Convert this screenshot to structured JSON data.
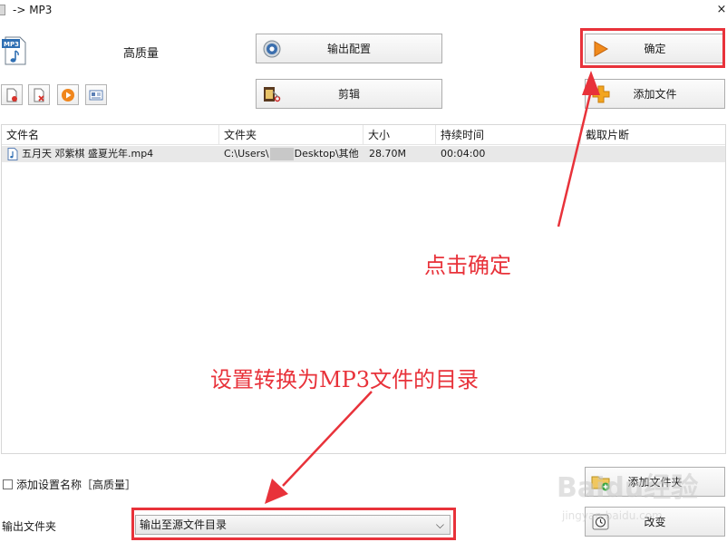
{
  "window": {
    "title": "-> MP3",
    "close_glyph": "×"
  },
  "header": {
    "quality_label": "高质量"
  },
  "buttons": {
    "output_config": "输出配置",
    "confirm": "确定",
    "edit": "剪辑",
    "add_file": "添加文件",
    "add_folder": "添加文件夹",
    "change": "改变"
  },
  "toolbar": {
    "icons": [
      "remove-file-icon",
      "clear-list-icon",
      "play-icon",
      "info-icon"
    ]
  },
  "filelist": {
    "columns": [
      "文件名",
      "文件夹",
      "大小",
      "持续时间",
      "截取片断"
    ],
    "rows": [
      {
        "name": "五月天 邓紫棋 盛夏光年.mp4",
        "folder_start": "C:\\Users\\",
        "folder_end": "Desktop\\其他",
        "size": "28.70M",
        "duration": "00:04:00",
        "clip": ""
      }
    ]
  },
  "options": {
    "add_setting_name": "添加设置名称［高质量］",
    "checked": false
  },
  "output": {
    "label": "输出文件夹",
    "selected": "输出至源文件目录"
  },
  "annotations": {
    "click_confirm": "点击确定",
    "set_dir": "设置转换为MP3文件的目录"
  },
  "watermark": {
    "main": "Baidu经验",
    "sub": "jingyan.baidu.com"
  },
  "colors": {
    "highlight": "#e8323a",
    "row_bg": "#e8e8e8"
  }
}
